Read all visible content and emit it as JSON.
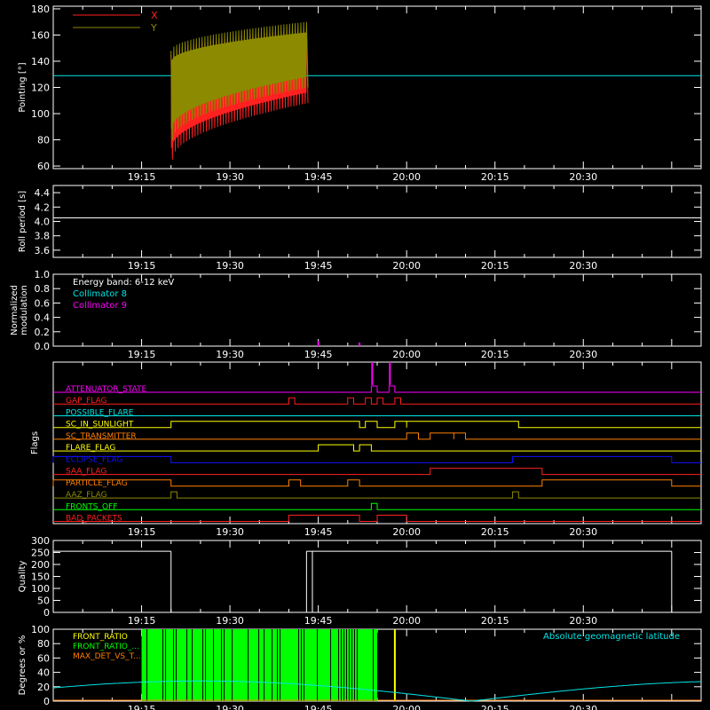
{
  "time_axis": {
    "start_minutes": 1140,
    "end_minutes": 1250,
    "tick_labels": [
      "19:15",
      "19:30",
      "19:45",
      "20:00",
      "20:15",
      "20:30"
    ],
    "tick_minutes": [
      1155,
      1170,
      1185,
      1200,
      1215,
      1230
    ]
  },
  "colors": {
    "axis": "#ffffff",
    "x_series": "#ff2020",
    "y_series": "#8c8a00",
    "cyan": "#00e5e5",
    "magenta": "#ff00ff",
    "green": "#00ff00",
    "yellow": "#ffff00",
    "orange": "#ff8000",
    "blue": "#1010ff",
    "red": "#ff2020",
    "olive": "#8c8a00"
  },
  "chart_data": [
    {
      "id": "pointing",
      "type": "line",
      "ylabel": "Pointing [°]",
      "ylim": [
        58,
        182
      ],
      "yticks": [
        60,
        80,
        100,
        120,
        140,
        160,
        180
      ],
      "legend": [
        "X",
        "Y"
      ],
      "reference_line": 129,
      "series": [
        {
          "name": "X",
          "x_range": [
            "19:20",
            "19:43"
          ],
          "envelope_low_start": 65,
          "envelope_low_end": 108,
          "envelope_high_start": 145,
          "envelope_high_end": 165
        },
        {
          "name": "Y",
          "x_range": [
            "19:20",
            "19:43"
          ],
          "envelope_low_start": 80,
          "envelope_low_end": 120,
          "envelope_high_start": 148,
          "envelope_high_end": 170
        }
      ]
    },
    {
      "id": "roll_period",
      "type": "line",
      "ylabel": "Roll period [s]",
      "ylim": [
        3.5,
        4.5
      ],
      "yticks": [
        "3.6",
        "3.8",
        "4.0",
        "4.2",
        "4.4"
      ],
      "value": 4.05
    },
    {
      "id": "modulation",
      "type": "line",
      "ylabel_line1": "Normalized",
      "ylabel_line2": "modulation",
      "ylim": [
        0,
        1.0
      ],
      "yticks": [
        "0.0",
        "0.2",
        "0.4",
        "0.6",
        "0.8",
        "1.0"
      ],
      "annotations": [
        "Energy band: 6-12 keV",
        "Collimator 8",
        "Collimator 9"
      ],
      "spikes": [
        {
          "t": "19:45",
          "v": 0.07
        },
        {
          "t": "19:52",
          "v": 0.05
        }
      ]
    },
    {
      "id": "flags",
      "type": "line",
      "ylabel": "Flags",
      "rows": [
        {
          "label": "ATTENUATOR_STATE",
          "color": "magenta",
          "pulses": [
            [
              "19:54",
              "19:55"
            ],
            [
              "19:57",
              "19:58"
            ]
          ]
        },
        {
          "label": "GAP_FLAG",
          "color": "red",
          "pulses": [
            [
              "19:40",
              "19:41"
            ],
            [
              "19:50",
              "19:51"
            ],
            [
              "19:53",
              "19:54"
            ],
            [
              "19:55",
              "19:56"
            ],
            [
              "19:58",
              "19:59"
            ]
          ]
        },
        {
          "label": "POSSIBLE_FLARE",
          "color": "cyan",
          "pulses": []
        },
        {
          "label": "SC_IN_SUNLIGHT",
          "color": "yellow",
          "pulses": [
            [
              "19:20",
              "19:52"
            ],
            [
              "19:53",
              "19:55"
            ],
            [
              "19:58",
              "20:00"
            ],
            [
              "20:00",
              "20:19"
            ]
          ]
        },
        {
          "label": "SC_TRANSMITTER",
          "color": "orange",
          "pulses": [
            [
              "20:00",
              "20:02"
            ],
            [
              "20:04",
              "20:08"
            ],
            [
              "20:08",
              "20:10"
            ]
          ]
        },
        {
          "label": "FLARE_FLAG",
          "color": "yellow",
          "pulses": [
            [
              "19:45",
              "19:51"
            ],
            [
              "19:52",
              "19:54"
            ]
          ]
        },
        {
          "label": "ECLIPSE_FLAG",
          "color": "blue",
          "pulses": [
            [
              "19:00",
              "19:20"
            ],
            [
              "20:18",
              "20:45"
            ]
          ]
        },
        {
          "label": "SAA_FLAG",
          "color": "red",
          "pulses": [
            [
              "20:04",
              "20:23"
            ]
          ]
        },
        {
          "label": "PARTICLE_FLAG",
          "color": "orange",
          "pulses": [
            [
              "19:00",
              "19:20"
            ],
            [
              "19:40",
              "19:42"
            ],
            [
              "19:50",
              "19:52"
            ],
            [
              "20:23",
              "20:45"
            ]
          ]
        },
        {
          "label": "AAZ_FLAG",
          "color": "olive",
          "pulses": [
            [
              "19:20",
              "19:21"
            ],
            [
              "20:18",
              "20:19"
            ]
          ]
        },
        {
          "label": "FRONTS_OFF",
          "color": "green",
          "pulses": [
            [
              "19:54",
              "19:55"
            ]
          ]
        },
        {
          "label": "BAD_PACKETS",
          "color": "red",
          "pulses": [
            [
              "19:40",
              "19:52"
            ],
            [
              "19:55",
              "20:00"
            ]
          ]
        }
      ]
    },
    {
      "id": "quality",
      "type": "line",
      "ylabel": "Quality",
      "ylim": [
        0,
        300
      ],
      "yticks": [
        0,
        50,
        100,
        150,
        200,
        250,
        300
      ],
      "segments": [
        {
          "x": [
            "19:00",
            "19:20"
          ],
          "y": 255
        },
        {
          "x": [
            "19:43",
            "19:44"
          ],
          "y": 255
        },
        {
          "x": [
            "19:44",
            "20:45"
          ],
          "y": 255
        }
      ]
    },
    {
      "id": "ratios",
      "type": "line",
      "ylabel": "Degrees or %",
      "ylim": [
        0,
        100
      ],
      "yticks": [
        0,
        20,
        40,
        60,
        80,
        100
      ],
      "legend": [
        "FRONT_RATIO",
        "FRONT_RATIO_...",
        "MAX_DET_VS_T..."
      ],
      "right_label": "Absolute geomagnetic latitude",
      "front_ratio_green_range": [
        "19:15",
        "19:55"
      ],
      "yellow_lines": [
        "19:58"
      ],
      "latitude": {
        "min": 0,
        "max": 28,
        "period_minutes": 92
      }
    }
  ]
}
